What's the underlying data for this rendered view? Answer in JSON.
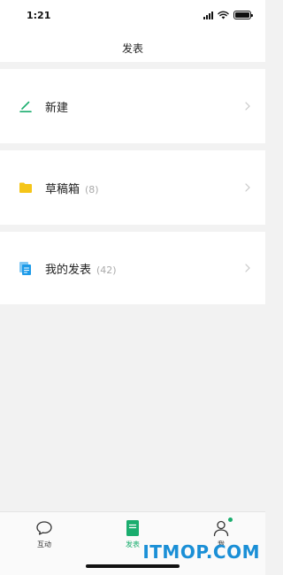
{
  "status_bar": {
    "time": "1:21"
  },
  "nav": {
    "title": "发表"
  },
  "rows": {
    "new": {
      "label": "新建",
      "icon": "pen-icon"
    },
    "draft": {
      "label": "草稿箱",
      "count": "(8)",
      "icon": "folder-icon"
    },
    "published": {
      "label": "我的发表",
      "count": "(42)",
      "icon": "documents-icon"
    }
  },
  "tabs": [
    {
      "label": "互动",
      "icon": "chat-bubble-icon",
      "active": false
    },
    {
      "label": "发表",
      "icon": "document-icon",
      "active": true
    },
    {
      "label": "我",
      "icon": "person-icon",
      "active": false,
      "badge": true
    }
  ],
  "watermark": "ITMOP.COM",
  "colors": {
    "accent": "#1aad6e",
    "folder": "#f5c518",
    "documents": "#1e9be9",
    "background": "#f2f2f2"
  }
}
